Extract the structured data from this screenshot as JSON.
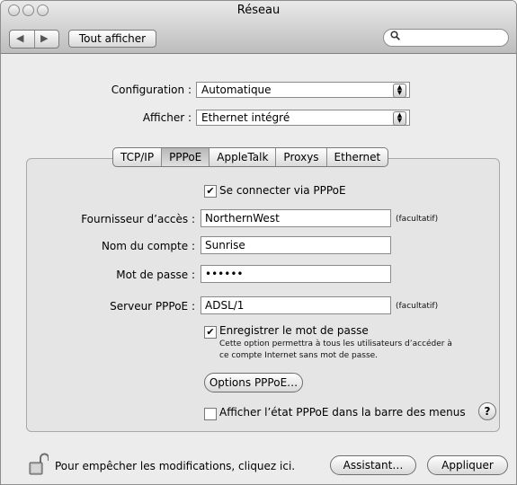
{
  "window": {
    "title": "Réseau"
  },
  "toolbar": {
    "back_glyph": "◀",
    "forward_glyph": "▶",
    "show_all_label": "Tout afficher",
    "search_placeholder": "",
    "search_icon": "magnifier-icon"
  },
  "config": {
    "configuration_label": "Configuration :",
    "configuration_value": "Automatique",
    "afficher_label": "Afficher :",
    "afficher_value": "Ethernet intégré"
  },
  "tabs": [
    {
      "label": "TCP/IP",
      "active": false
    },
    {
      "label": "PPPoE",
      "active": true
    },
    {
      "label": "AppleTalk",
      "active": false
    },
    {
      "label": "Proxys",
      "active": false
    },
    {
      "label": "Ethernet",
      "active": false
    }
  ],
  "pppoe": {
    "connect_label": "Se connecter via PPPoE",
    "connect_checked": true,
    "provider_label": "Fournisseur d’accès :",
    "provider_value": "NorthernWest",
    "provider_note": "(facultatif)",
    "account_label": "Nom du compte :",
    "account_value": "Sunrise",
    "password_label": "Mot de passe :",
    "password_value": "••••••",
    "server_label": "Serveur PPPoE :",
    "server_value": "ADSL/1",
    "server_note": "(facultatif)",
    "save_pw_label": "Enregistrer le mot de passe",
    "save_pw_checked": true,
    "save_pw_desc_1": "Cette option permettra à tous les utilisateurs d’accéder à",
    "save_pw_desc_2": "ce compte Internet sans mot de passe.",
    "options_button": "Options PPPoE…",
    "show_status_label": "Afficher l’état PPPoE dans la barre des menus",
    "show_status_checked": false,
    "help_label": "?"
  },
  "footer": {
    "lock_text": "Pour empêcher les modifications, cliquez ici.",
    "assistant_button": "Assistant…",
    "apply_button": "Appliquer"
  }
}
